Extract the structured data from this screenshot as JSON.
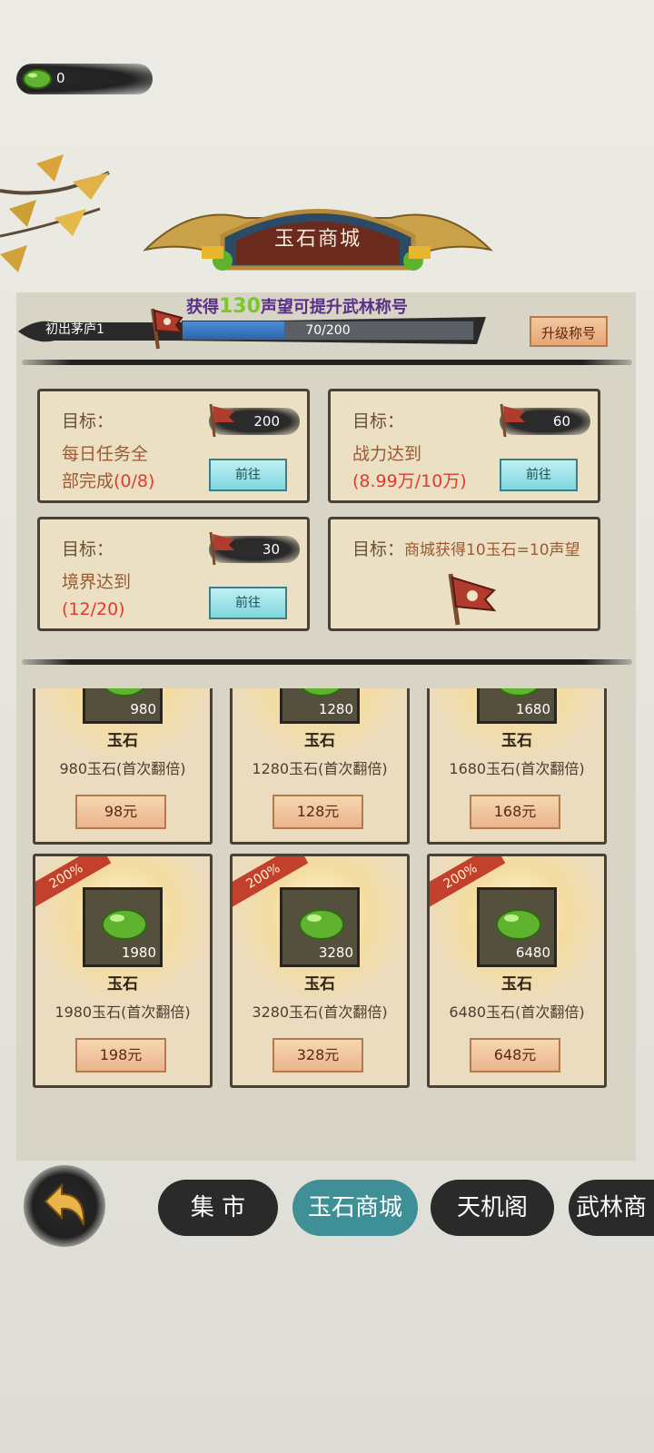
{
  "currency": {
    "icon": "jade-gem-icon",
    "value": "0"
  },
  "title": "玉石商城",
  "rank": {
    "name": "初出茅庐1",
    "hint_prefix": "获得",
    "hint_amount": "130",
    "hint_suffix": "声望可提升武林称号",
    "progress_text": "70/200",
    "progress_fraction": 0.35,
    "upgrade_label": "升级称号"
  },
  "goals": [
    {
      "label": "目标：",
      "desc_line1": "每日任务全",
      "desc_line2_prefix": "部完成",
      "desc_progress": "(0/8)",
      "reward": "200",
      "button": "前往"
    },
    {
      "label": "目标：",
      "desc_line1": "战力达到",
      "desc_progress": "(8.99万/10万)",
      "reward": "60",
      "button": "前往"
    },
    {
      "label": "目标：",
      "desc_line1": "境界达到",
      "desc_progress": "(12/20)",
      "reward": "30",
      "button": "前往"
    },
    {
      "label": "目标：",
      "note": "商城获得10玉石=10声望"
    }
  ],
  "shop_items": [
    {
      "count": "980",
      "name": "玉石",
      "desc": "980玉石(首次翻倍)",
      "price": "98元"
    },
    {
      "count": "1280",
      "name": "玉石",
      "desc": "1280玉石(首次翻倍)",
      "price": "128元"
    },
    {
      "count": "1680",
      "name": "玉石",
      "desc": "1680玉石(首次翻倍)",
      "price": "168元"
    },
    {
      "count": "1980",
      "name": "玉石",
      "desc": "1980玉石(首次翻倍)",
      "price": "198元",
      "tag": "200%"
    },
    {
      "count": "3280",
      "name": "玉石",
      "desc": "3280玉石(首次翻倍)",
      "price": "328元",
      "tag": "200%"
    },
    {
      "count": "6480",
      "name": "玉石",
      "desc": "6480玉石(首次翻倍)",
      "price": "648元",
      "tag": "200%"
    }
  ],
  "tabs": [
    {
      "label": "集 市",
      "active": false
    },
    {
      "label": "玉石商城",
      "active": true
    },
    {
      "label": "天机阁",
      "active": false
    },
    {
      "label": "武林商",
      "active": false
    }
  ],
  "colors": {
    "accent_tab": "#3f8f96",
    "jade": "#5fb32e",
    "progress_text_red": "#e23a2b"
  }
}
